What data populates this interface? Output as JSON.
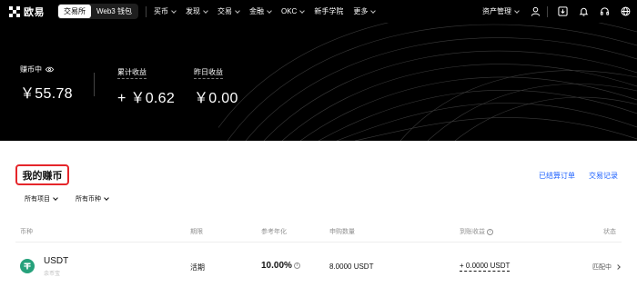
{
  "nav": {
    "logo_text": "欧易",
    "mode_tabs": [
      {
        "label": "交易所",
        "active": true
      },
      {
        "label": "Web3 钱包",
        "active": false
      }
    ],
    "menu": [
      "买币",
      "发现",
      "交易",
      "金融",
      "OKC",
      "新手学院",
      "更多"
    ],
    "asset_menu": "资产管理",
    "icons": [
      "user-icon",
      "download-icon",
      "bell-icon",
      "headset-icon",
      "globe-icon"
    ]
  },
  "hero": {
    "earning_label": "赚币中",
    "earning_value": "￥55.78",
    "total_label": "累计收益",
    "total_value": "+ ￥0.62",
    "yesterday_label": "昨日收益",
    "yesterday_value": "￥0.00"
  },
  "main": {
    "title": "我的赚币",
    "links": {
      "settled": "已结算订单",
      "history": "交易记录"
    },
    "filters": {
      "project": "所有项目",
      "coin": "所有币种"
    },
    "columns": [
      "币种",
      "期限",
      "参考年化",
      "申购数量",
      "到账收益",
      "状态"
    ],
    "rows": [
      {
        "coin": "USDT",
        "product": "余币宝",
        "term": "活期",
        "apy": "10.00%",
        "amount": "8.0000 USDT",
        "earnings": "+ 0.0000 USDT",
        "status": "匹配中"
      }
    ]
  },
  "colors": {
    "accent": "#1d61ff",
    "highlight": "#e5262b",
    "usdt": "#26a17b"
  }
}
